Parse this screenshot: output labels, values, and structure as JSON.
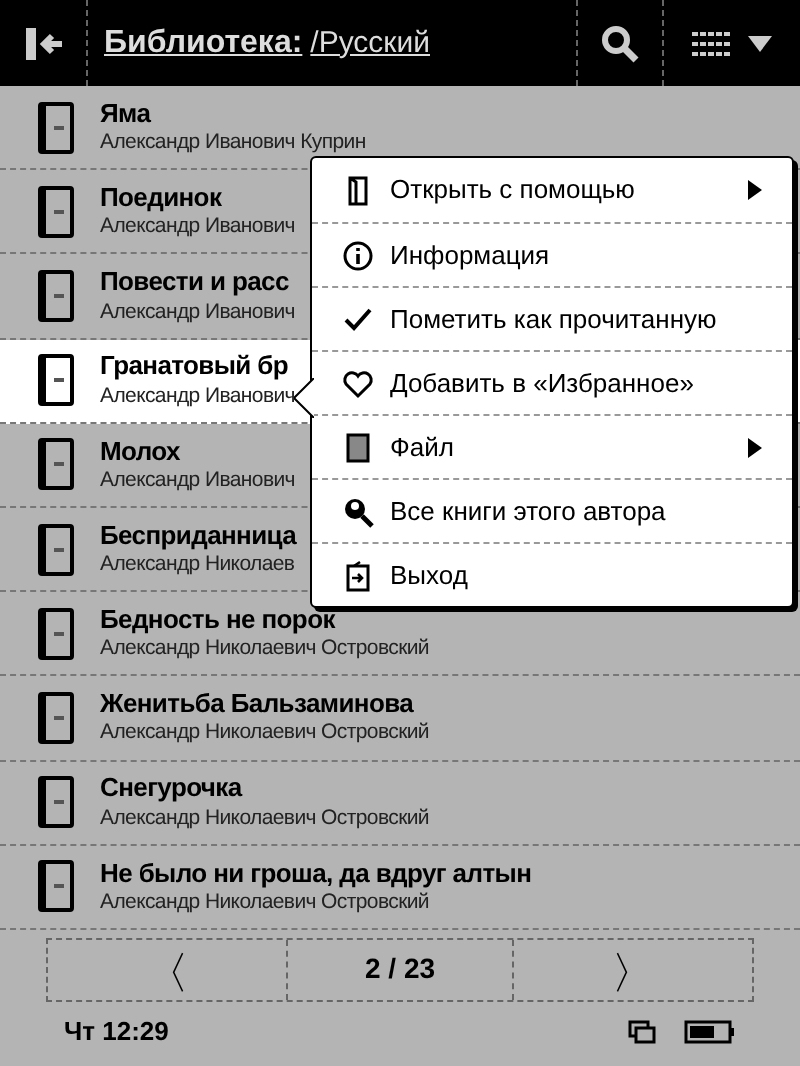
{
  "header": {
    "title": "Библиотека:",
    "path": "/Русский"
  },
  "books": [
    {
      "title": "Яма",
      "author": "Александр Иванович Куприн",
      "selected": false
    },
    {
      "title": "Поединок",
      "author": "Александр Иванович",
      "selected": false
    },
    {
      "title": "Повести и расс",
      "author": "Александр Иванович",
      "selected": false
    },
    {
      "title": "Гранатовый бр",
      "author": "Александр Иванович",
      "selected": true
    },
    {
      "title": "Молох",
      "author": "Александр Иванович",
      "selected": false
    },
    {
      "title": "Бесприданница",
      "author": "Александр Николаев",
      "selected": false
    },
    {
      "title": "Бедность не порок",
      "author": "Александр Николаевич Островский",
      "selected": false
    },
    {
      "title": "Женитьба Бальзаминова",
      "author": "Александр Николаевич Островский",
      "selected": false
    },
    {
      "title": "Снегурочка",
      "author": "Александр Николаевич Островский",
      "selected": false
    },
    {
      "title": "Не было ни гроша, да вдруг алтын",
      "author": "Александр Николаевич Островский",
      "selected": false
    }
  ],
  "context_menu": [
    {
      "label": "Открыть с помощью",
      "kind": "open",
      "submenu": true
    },
    {
      "label": "Информация",
      "kind": "info",
      "submenu": false
    },
    {
      "label": "Пометить как прочитанную",
      "kind": "check",
      "submenu": false
    },
    {
      "label": "Добавить в «Избранное»",
      "kind": "heart",
      "submenu": false
    },
    {
      "label": "Файл",
      "kind": "file",
      "submenu": true
    },
    {
      "label": "Все книги этого автора",
      "kind": "author",
      "submenu": false
    },
    {
      "label": "Выход",
      "kind": "exit",
      "submenu": false
    }
  ],
  "pagination": {
    "prev": "〈",
    "page": "2 / 23",
    "next": "〉"
  },
  "status_bar": {
    "time": "Чт 12:29"
  }
}
